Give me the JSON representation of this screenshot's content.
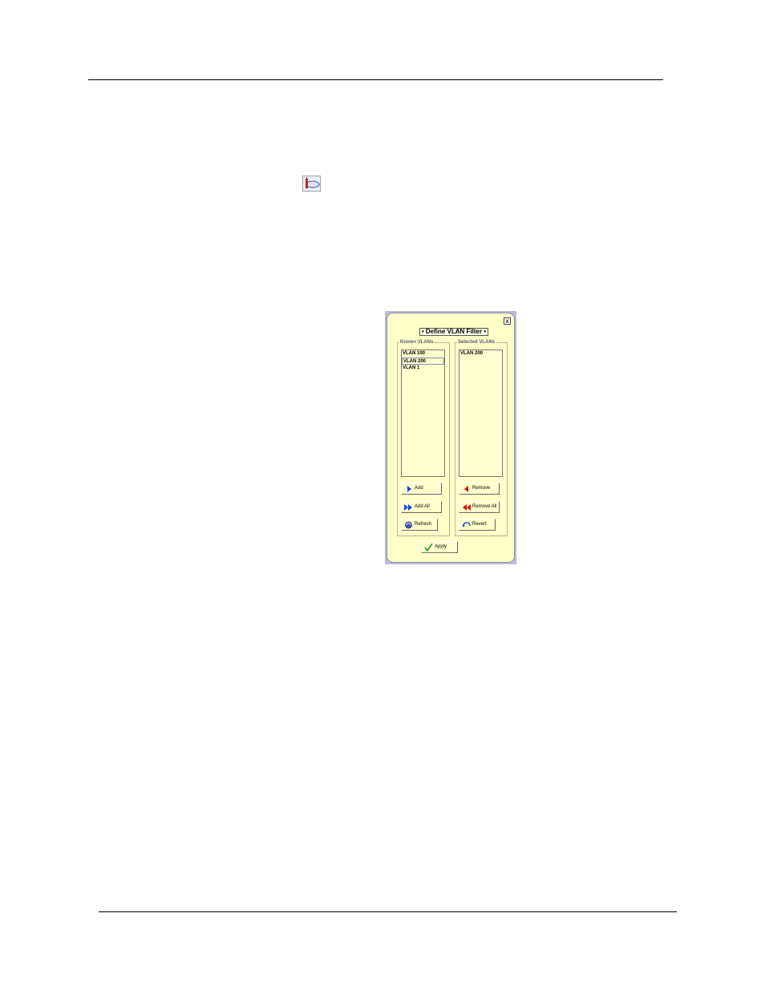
{
  "dialog": {
    "title": "• Define VLAN Filter •",
    "close_glyph": "x",
    "known": {
      "label": "Known VLANs",
      "items": [
        "VLAN 100",
        "VLAN 200",
        "VLAN 1"
      ]
    },
    "selected": {
      "label": "Selected VLANs",
      "items": [
        "VLAN 200"
      ]
    },
    "buttons": {
      "add": "Add",
      "add_all": "Add All",
      "refresh": "Refresh",
      "remove": "Remove",
      "remove_all": "Remove All",
      "revert": "Revert",
      "apply": "Apply"
    }
  },
  "colors": {
    "dialog_bg": "#ffffc8",
    "frame": "#b8bcd8",
    "add_arrow": "#1a3cff",
    "remove_arrow": "#e01010",
    "apply_check": "#2a9a2a"
  },
  "icons": {
    "inline": "filter-tool-icon",
    "add": "arrow-right-icon",
    "add_all": "double-arrow-right-icon",
    "refresh": "refresh-icon",
    "remove": "arrow-left-icon",
    "remove_all": "double-arrow-left-icon",
    "revert": "revert-icon",
    "apply": "checkmark-icon"
  }
}
